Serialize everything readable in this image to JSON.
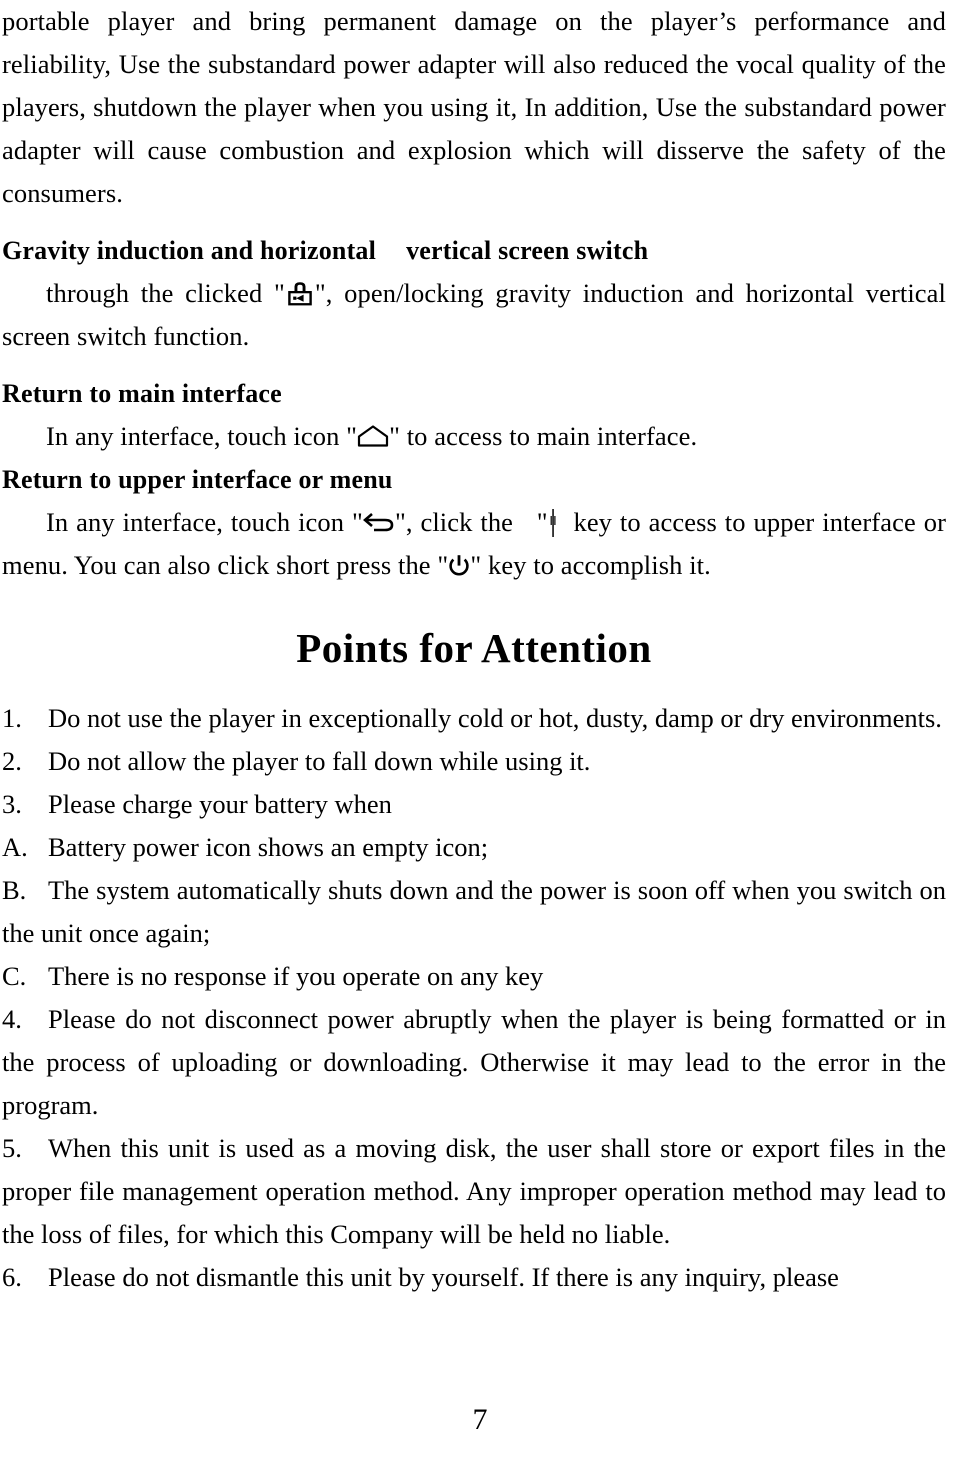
{
  "document": {
    "page_number": "7",
    "paragraph_continued": "portable player and bring permanent damage on the player’s performance and reliability, Use the substandard power adapter will also reduced the vocal quality of the players, shutdown the player when you using it, In addition, Use the substandard power adapter will cause combustion and explosion which will disserve the safety of the consumers.",
    "sections": [
      {
        "heading_part1": "Gravity induction and horizontal",
        "heading_part2": "vertical screen switch",
        "body_before_icon": "through the clicked \"",
        "icon": "lock-icon",
        "body_after_icon": "\", open/locking gravity induction and horizontal vertical screen switch function."
      },
      {
        "heading": "Return to main interface",
        "body_before_icon": "In any interface, touch icon \"",
        "icon": "home-icon",
        "body_after_icon": "\" to access to main interface."
      },
      {
        "heading": "Return to upper interface or menu",
        "body_part1": "In any interface, touch icon \"",
        "icon1": "back-arrow-icon",
        "body_part2": "\", click the",
        "quote_open": "\"",
        "icon2": "menu-key-icon",
        "body_part3": "key to access to upper interface or menu. You can also click short press the \"",
        "icon3": "power-icon",
        "body_part4": "\" key to accomplish it."
      }
    ],
    "attention": {
      "title": "Points for Attention",
      "items": [
        {
          "marker": "1.",
          "text": "Do not use the player in exceptionally cold or hot, dusty, damp or dry environments."
        },
        {
          "marker": "2.",
          "text": "Do not allow the player to fall down while using it."
        },
        {
          "marker": "3.",
          "text": "Please charge your battery when"
        },
        {
          "marker": "A.",
          "text": "Battery power icon shows an empty icon;"
        },
        {
          "marker": "B.",
          "text": "The system automatically shuts down and the power is soon off when you switch on the unit once again;"
        },
        {
          "marker": "C.",
          "text": "There is no response if you operate on any key"
        },
        {
          "marker": "4.",
          "text": "Please do not disconnect power abruptly when the player is being formatted or in the process of uploading or downloading. Otherwise it may lead to the error in the program."
        },
        {
          "marker": "5.",
          "text": "When this unit is used as a moving disk, the user shall store or export files in the proper file management operation method. Any improper operation method may lead to the loss of files, for which this Company will be held no liable."
        },
        {
          "marker": "6.",
          "text": "Please do not dismantle this unit by yourself. If there is any inquiry, please"
        }
      ]
    },
    "colors": {
      "text": "#000000",
      "background": "#ffffff"
    }
  }
}
